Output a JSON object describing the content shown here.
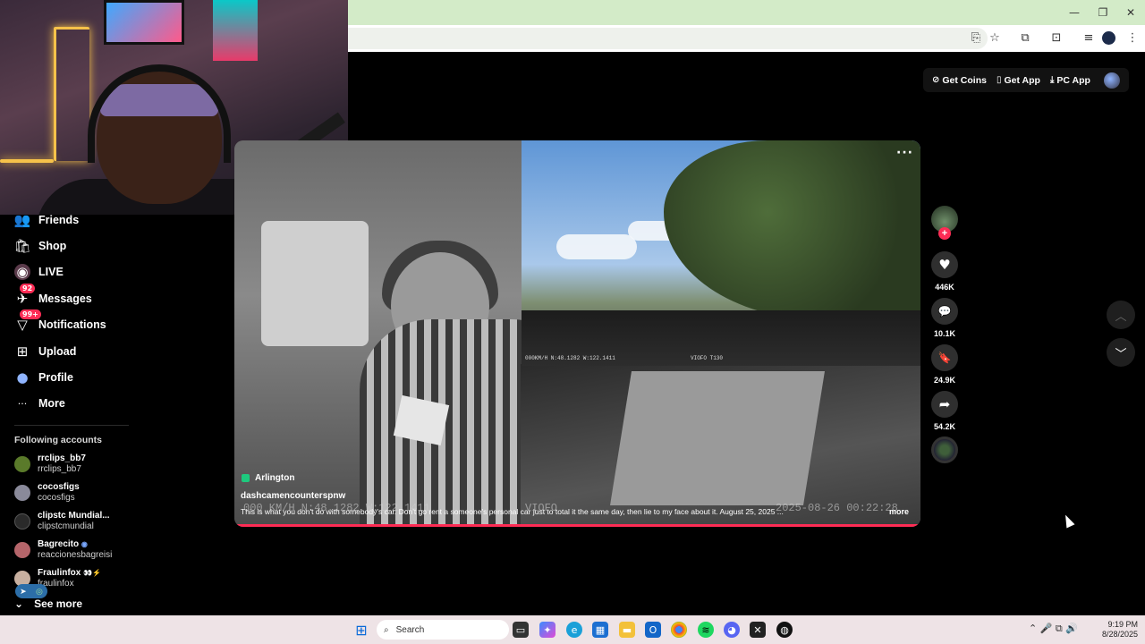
{
  "window": {
    "minimize_glyph": "—",
    "maximize_glyph": "❐",
    "close_glyph": "✕"
  },
  "sidebar": {
    "items": [
      {
        "label": "Friends",
        "icon": "friends-icon",
        "glyph": "👥"
      },
      {
        "label": "Shop",
        "icon": "shop-icon",
        "glyph": "🛍"
      },
      {
        "label": "LIVE",
        "icon": "live-icon",
        "glyph": "◉"
      },
      {
        "label": "Messages",
        "icon": "messages-icon",
        "glyph": "✈",
        "badge": "92"
      },
      {
        "label": "Notifications",
        "icon": "notifications-icon",
        "glyph": "▽",
        "badge": "99+"
      },
      {
        "label": "Upload",
        "icon": "upload-icon",
        "glyph": "⊞"
      },
      {
        "label": "Profile",
        "icon": "profile-icon",
        "glyph": "●"
      },
      {
        "label": "More",
        "icon": "more-icon",
        "glyph": "···"
      }
    ],
    "following_heading": "Following accounts",
    "accounts": [
      {
        "name": "rrclips_bb7",
        "username": "rrclips_bb7",
        "color": "#5a7a2a"
      },
      {
        "name": "cocosfigs",
        "username": "cocosfigs",
        "color": "#8a8a9a"
      },
      {
        "name": "clipstc Mundial...",
        "username": "clipstcmundial",
        "color": "#2a2a2a"
      },
      {
        "name": "Bagrecito",
        "username": "reaccionesbagreisi",
        "color": "#b5656a",
        "verified_glyph": "◉"
      },
      {
        "name": "Fraulinfox",
        "username": "fraulinfox",
        "color": "#c8b0a0",
        "extra_glyph": "👀⚡"
      }
    ],
    "see_more": "See more",
    "see_more_glyph": "⌄"
  },
  "topbar": {
    "get_coins": "Get Coins",
    "get_app": "Get App",
    "pc_app": "PC App",
    "coins_glyph": "⊘",
    "app_glyph": "▯",
    "pc_glyph": "⤓"
  },
  "video": {
    "location": "Arlington",
    "author": "dashcamencounterspnw",
    "caption": "This is what you don't do with somebody's car. Don't go rent a someone's personal car just to total it the same day, then lie to my face about it. August 25, 2025 ...",
    "more": "more",
    "options_glyph": "···",
    "cam_overlay_front": "000KM/H   N:48.1282  W:122.1411",
    "cam_brand": "VIOFO T130",
    "cam_overlay_bottom": "000 KM/H  N:48.1282  W:122.1411",
    "cam_brand_bottom": "VIOFO",
    "cam_timestamp": "2025-08-26  00:22:28",
    "progress": 1.0
  },
  "actions": {
    "likes": "446K",
    "comments": "10.1K",
    "saves": "24.9K",
    "shares": "54.2K",
    "like_glyph": "♥",
    "comment_glyph": "💬",
    "save_glyph": "🔖",
    "share_glyph": "➦",
    "follow_glyph": "+",
    "prev_glyph": "︿",
    "next_glyph": "﹀"
  },
  "taskbar": {
    "search_placeholder": "Search",
    "time": "9:19 PM",
    "date": "8/28/2025",
    "tray_glyphs": "⌃  🎤  ⧉  🔊"
  },
  "colors": {
    "accent": "#fe2c55",
    "titlebar": "#d3ebc8",
    "taskbar": "#eee3e6"
  }
}
